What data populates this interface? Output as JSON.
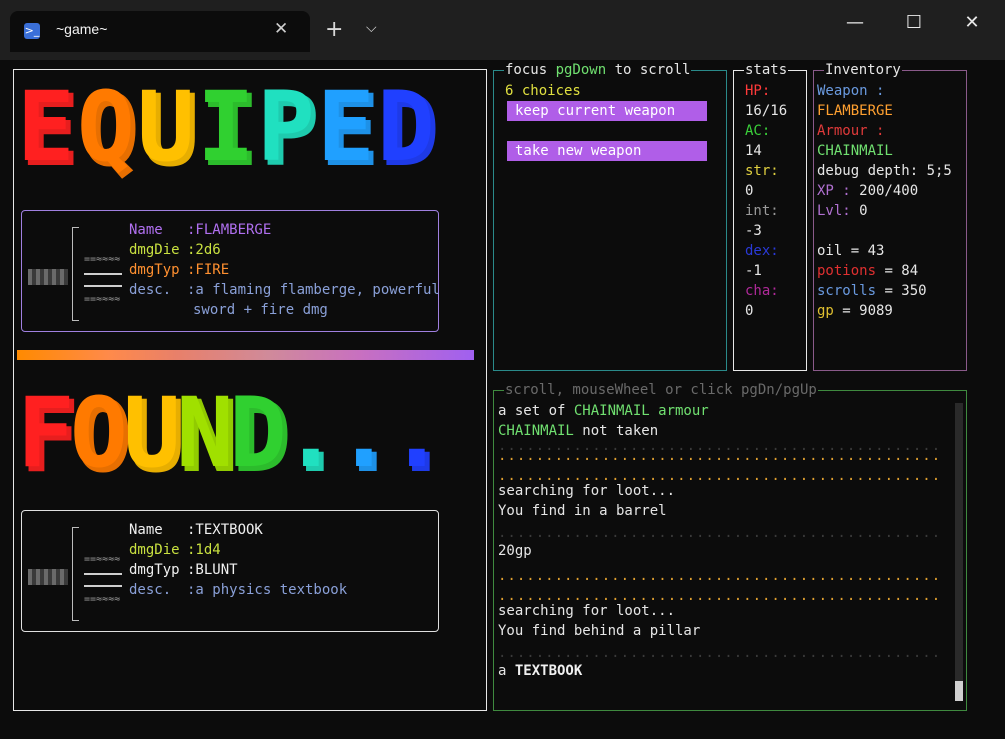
{
  "window": {
    "tab_title": "~game~",
    "tab_icon": "terminal-icon",
    "close_tab": "✕",
    "new_tab": "+",
    "dropdown": "⌵",
    "minimize": "—",
    "maximize": "☐",
    "close": "✕"
  },
  "equip_panel": {
    "banner_top": "EQUIPED",
    "banner_bottom": "FOUND...",
    "equipped": {
      "name_key": "Name",
      "name_val": ":FLAMBERGE",
      "die_key": "dmgDie",
      "die_val": ":2d6",
      "type_key": "dmgTyp",
      "type_val": ":FIRE",
      "desc_key": "desc.",
      "desc_val": ":a flaming flamberge, powerful",
      "desc_val2": "sword + fire dmg"
    },
    "found": {
      "name_key": "Name",
      "name_val": ":TEXTBOOK",
      "die_key": "dmgDie",
      "die_val": ":1d4",
      "type_key": "dmgTyp",
      "type_val": ":BLUNT",
      "desc_key": "desc.",
      "desc_val": ":a physics textbook"
    },
    "sword_edge": "==≈≈≈≈"
  },
  "focus_panel": {
    "title_a": "focus ",
    "title_key": "pgDown",
    "title_b": " to scroll",
    "choices_count": "6 choices",
    "choices": [
      "keep current weapon",
      "take new weapon"
    ]
  },
  "stats_panel": {
    "title": "stats",
    "items": [
      {
        "label": "HP:",
        "value": "16/16",
        "color": "#ff3a3a"
      },
      {
        "label": "AC:",
        "value": "14",
        "color": "#3ad03a"
      },
      {
        "label": "str:",
        "value": "0",
        "color": "#e0d040"
      },
      {
        "label": "int:",
        "value": "-3",
        "color": "#9a9a9a"
      },
      {
        "label": "dex:",
        "value": "-1",
        "color": "#2a3ad8"
      },
      {
        "label": "cha:",
        "value": "0",
        "color": "#b02a9a"
      }
    ]
  },
  "inventory_panel": {
    "title": "Inventory",
    "weapon_label": "Weapon :",
    "weapon_value": "FLAMBERGE",
    "armour_label": "Armour :",
    "armour_value": "CHAINMAIL",
    "debug": "debug depth: 5;5",
    "xp_label": "XP :",
    "xp_value": " 200/400",
    "lvl_label": "Lvl:",
    "lvl_value": " 0",
    "oil_label": "oil",
    "oil_value": " = 43",
    "potions_label": "potions",
    "potions_value": " = 84",
    "scrolls_label": "scrolls",
    "scrolls_value": " = 350",
    "gp_label": "gp",
    "gp_value": " = 9089"
  },
  "log_panel": {
    "title": "scroll, mouseWheel or click pgDn/pgUp",
    "lines": {
      "l1a": "a set of ",
      "l1b": "CHAINMAIL armour",
      "l2a": "CHAINMAIL",
      "l2b": " not taken",
      "l3": "searching for loot...",
      "l4": "You find in a barrel",
      "l5": "20gp",
      "l6": "searching for loot...",
      "l7": "You find behind a pillar",
      "l8a": "a ",
      "l8b": "TEXTBOOK"
    },
    "dots": "..............................................................",
    "faint_dots": ".............................................................."
  }
}
